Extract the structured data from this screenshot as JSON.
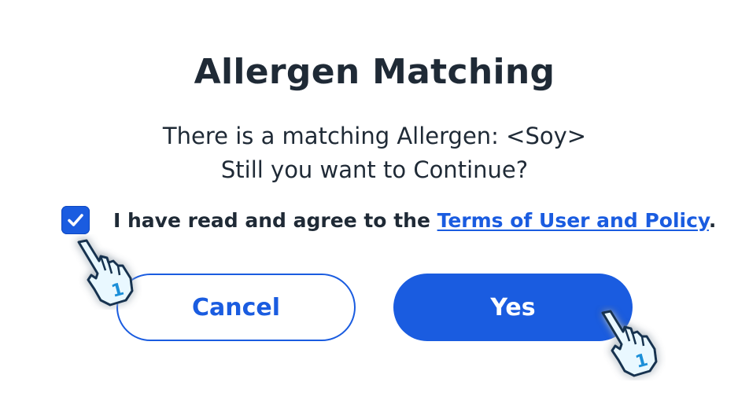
{
  "dialog": {
    "title": "Allergen Matching",
    "message_line1": "There is a matching Allergen: <Soy>",
    "message_line2": "Still you want to Continue?"
  },
  "agreement": {
    "checked": true,
    "text_before": "I have read and agree to the ",
    "link_text": "Terms of User and Policy",
    "text_after": "."
  },
  "buttons": {
    "cancel_label": "Cancel",
    "yes_label": "Yes"
  },
  "cursors": [
    {
      "icon": "hand-pointer-icon",
      "badge": "1"
    },
    {
      "icon": "hand-pointer-icon",
      "badge": "1"
    }
  ],
  "colors": {
    "accent": "#1a5ce0",
    "text": "#1f2a36",
    "cursor_glow": "#7fd3ff"
  }
}
